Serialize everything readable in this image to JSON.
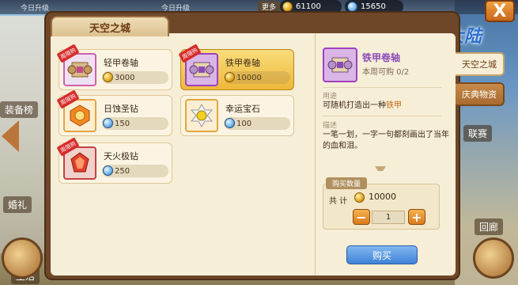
{
  "topbar": {
    "left_text": "今日升级",
    "mid_text": "今日升级",
    "more_label": "更多",
    "currencies": [
      {
        "name": "gold",
        "value": "61100"
      },
      {
        "name": "diamond",
        "value": "15650"
      }
    ]
  },
  "logo": {
    "text": "风之大陆"
  },
  "close": {
    "label": "X"
  },
  "shop": {
    "title": "天空之城",
    "badge_text": "周限购",
    "items": [
      {
        "name": "轻甲卷轴",
        "price": "3000",
        "currency": "gold",
        "icon": "scroll-icon",
        "frame": "pink",
        "selected": false
      },
      {
        "name": "铁甲卷轴",
        "price": "10000",
        "currency": "gold",
        "icon": "scroll-icon",
        "frame": "purple",
        "selected": true
      },
      {
        "name": "日蚀圣钻",
        "price": "150",
        "currency": "diamond",
        "icon": "sun-gem-icon",
        "frame": "gold",
        "selected": false
      },
      {
        "name": "幸运宝石",
        "price": "100",
        "currency": "diamond",
        "icon": "lucky-gem-icon",
        "frame": "gold",
        "selected": false
      },
      {
        "name": "天火极钻",
        "price": "250",
        "currency": "diamond",
        "icon": "fire-gem-icon",
        "frame": "red",
        "selected": false
      }
    ]
  },
  "detail": {
    "name": "铁甲卷轴",
    "limit": "本周可购 0/2",
    "usage_label": "用途",
    "usage_prefix": "可随机打造出一种",
    "usage_highlight": "铁甲",
    "desc_label": "描述",
    "desc_text": "一笔一划，一字一句都刻画出了当年的血和泪。",
    "buy_qty_label": "购买数量",
    "total_label": "共 计",
    "total_value": "10000",
    "quantity": "1",
    "minus": "−",
    "plus": "+",
    "buy_button": "购买"
  },
  "side_tabs": [
    {
      "label": "天空之城",
      "active": true
    },
    {
      "label": "庆典物资",
      "active": false
    }
  ],
  "background_labels": {
    "left_1": "装备榜",
    "left_2": "婚礼",
    "left_3": "生活",
    "right_1": "联赛",
    "right_2": "回廊"
  },
  "colors": {
    "accent_purple": "#8a4bb8",
    "highlight_orange": "#c56b10",
    "buy_blue": "#3f82d8"
  }
}
